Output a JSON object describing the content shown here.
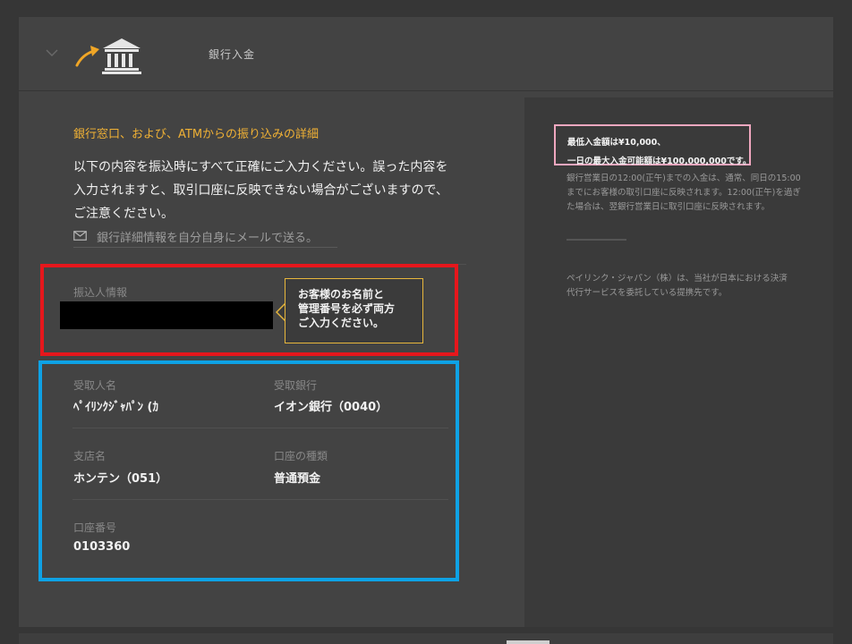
{
  "header": {
    "title": "銀行入金",
    "chevron_icon": "chevron-down-icon",
    "arrow_icon": "curved-arrow-icon",
    "bank_icon": "bank-building-icon",
    "arrow_color": "#f0a626"
  },
  "main": {
    "section_title": "銀行窓口、および、ATMからの振り込みの詳細",
    "instructions": [
      "以下の内容を振込時にすべて正確にご入力ください。誤った内容を",
      "入力されますと、取引口座に反映できない場合がございますので、",
      "ご注意ください。"
    ],
    "email_link": "銀行詳細情報を自分自身にメールで送る。",
    "email_icon": "envelope-icon",
    "remitter": {
      "label": "振込人情報"
    },
    "tooltip": {
      "lines": [
        "お客様のお名前と",
        "管理番号を必ず両方",
        "ご入力ください。"
      ]
    },
    "fields": {
      "payee_name": {
        "label": "受取人名",
        "value": "ﾍﾟｲﾘﾝｸｼﾞｬﾊﾟﾝ (ｶ"
      },
      "payee_bank": {
        "label": "受取銀行",
        "value": "イオン銀行（0040）"
      },
      "branch_name": {
        "label": "支店名",
        "value": "ホンテン（051）"
      },
      "account_type": {
        "label": "口座の種類",
        "value": "普通預金"
      },
      "account_number": {
        "label": "口座番号",
        "value": "0103360"
      }
    }
  },
  "sidebar": {
    "min_deposit": "最低入金額は¥10,000、",
    "max_deposit": "一日の最大入金可能額は¥100,000,000です。",
    "note": "銀行営業日の12:00(正午)までの入金は、通常、同日の15:00までにお客様の取引口座に反映されます。12:00(正午)を過ぎた場合は、翌銀行営業日に取引口座に反映されます。",
    "partner": "ペイリンク・ジャパン（株）は、当社が日本における決済代行サービスを委託している提携先です。"
  },
  "colors": {
    "accent": "#f0b135",
    "highlight_red": "#e6171c",
    "highlight_blue": "#0ea2e5",
    "highlight_pink": "#f0a7bf",
    "panel": "#434343",
    "sidebar": "#3a3a3a"
  }
}
